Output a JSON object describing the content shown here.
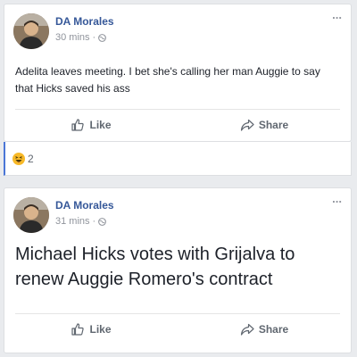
{
  "posts": [
    {
      "author": "DA Morales",
      "time": "30 mins",
      "text": "Adelita leaves meeting. I bet she's calling her man Auggie to say that Hicks saved his ass",
      "like_label": "Like",
      "share_label": "Share",
      "reactions": {
        "icon": "haha-reaction-icon",
        "count": "2"
      }
    },
    {
      "author": "DA Morales",
      "time": "31 mins",
      "text": "Michael Hicks votes with Grijalva to renew Auggie Romero's contract",
      "like_label": "Like",
      "share_label": "Share"
    }
  ],
  "more_label": "...",
  "dot": "·",
  "colors": {
    "author": "#365899",
    "meta": "#90949c",
    "action": "#606770",
    "background": "#e9ebee",
    "reaction_highlight": "#4a76d6"
  }
}
